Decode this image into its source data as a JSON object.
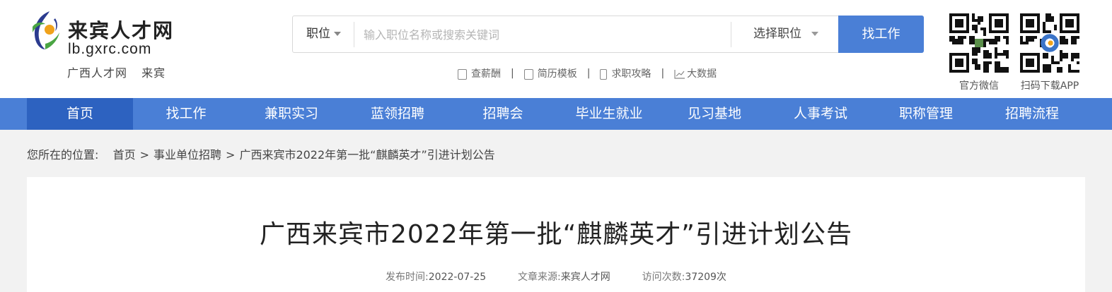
{
  "logo": {
    "name_cn": "来宾人才网",
    "domain": "lb.gxrc.com",
    "sub_left": "广西人才网",
    "sub_right": "来宾"
  },
  "search": {
    "type_label": "职位",
    "placeholder": "输入职位名称或搜索关键词",
    "category_label": "选择职位",
    "button_label": "找工作"
  },
  "quick_links": [
    {
      "label": "查薪酬",
      "icon": "salary-doc-icon"
    },
    {
      "label": "简历模板",
      "icon": "resume-template-icon"
    },
    {
      "label": "求职攻略",
      "icon": "guide-phone-icon"
    },
    {
      "label": "大数据",
      "icon": "line-chart-icon"
    }
  ],
  "qr_codes": [
    {
      "label": "官方微信"
    },
    {
      "label": "扫码下载APP"
    }
  ],
  "nav": [
    {
      "label": "首页"
    },
    {
      "label": "找工作"
    },
    {
      "label": "兼职实习"
    },
    {
      "label": "蓝领招聘"
    },
    {
      "label": "招聘会"
    },
    {
      "label": "毕业生就业"
    },
    {
      "label": "见习基地"
    },
    {
      "label": "人事考试"
    },
    {
      "label": "职称管理"
    },
    {
      "label": "招聘流程"
    }
  ],
  "breadcrumb": {
    "prefix": "您所在的位置:",
    "items": [
      "首页",
      "事业单位招聘",
      "广西来宾市2022年第一批“麒麟英才”引进计划公告"
    ],
    "separator": ">"
  },
  "article": {
    "title": "广西来宾市2022年第一批“麒麟英才”引进计划公告",
    "publish_label": "发布时间:",
    "publish_date": "2022-07-25",
    "source_label": "文章来源:",
    "source": "来宾人才网",
    "visits_label": "访问次数:",
    "visits": "37209次"
  },
  "colors": {
    "brand_blue": "#4a7fd6",
    "nav_active": "#2d62c0"
  }
}
